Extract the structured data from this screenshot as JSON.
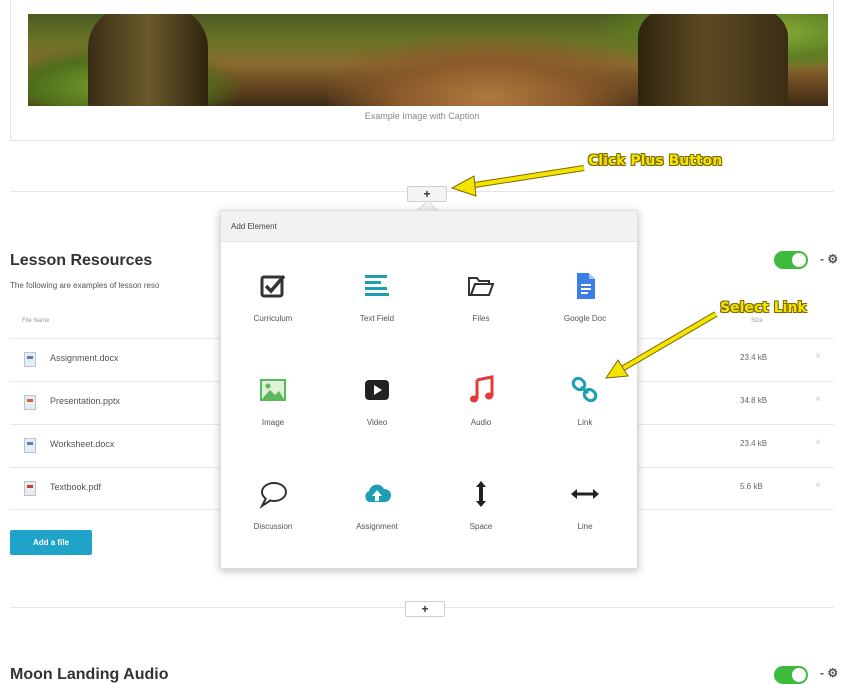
{
  "image_block": {
    "caption": "Example Image with Caption"
  },
  "annotations": {
    "click_plus": "Click Plus Button",
    "select_link": "Select Link"
  },
  "plus_label": "+",
  "lesson_resources": {
    "title": "Lesson Resources",
    "description": "The following are examples of lesson reso",
    "col_name": "File Name",
    "col_size": "Size",
    "files": [
      {
        "name": "Assignment.docx",
        "size": "23.4 kB"
      },
      {
        "name": "Presentation.pptx",
        "size": "34.8 kB"
      },
      {
        "name": "Worksheet.docx",
        "size": "23.4 kB"
      },
      {
        "name": "Textbook.pdf",
        "size": "5.6 kB"
      }
    ],
    "delete_symbol": "×",
    "add_file": "Add a file",
    "toggle_suffix": "- ⚙"
  },
  "add_element": {
    "header": "Add Element",
    "items": [
      {
        "label": "Curriculum",
        "icon": "checkbox-icon"
      },
      {
        "label": "Text Field",
        "icon": "text-lines-icon"
      },
      {
        "label": "Files",
        "icon": "folder-icon"
      },
      {
        "label": "Google Doc",
        "icon": "google-doc-icon"
      },
      {
        "label": "Image",
        "icon": "image-icon"
      },
      {
        "label": "Video",
        "icon": "play-icon"
      },
      {
        "label": "Audio",
        "icon": "music-note-icon"
      },
      {
        "label": "Link",
        "icon": "link-icon"
      },
      {
        "label": "Discussion",
        "icon": "speech-bubble-icon"
      },
      {
        "label": "Assignment",
        "icon": "cloud-upload-icon"
      },
      {
        "label": "Space",
        "icon": "vertical-arrows-icon"
      },
      {
        "label": "Line",
        "icon": "horizontal-arrows-icon"
      }
    ]
  },
  "moon_landing": {
    "title": "Moon Landing Audio",
    "toggle_suffix": "- ⚙"
  },
  "colors": {
    "accent": "#1fa3c9",
    "toggle_on": "#3dbb3d",
    "annotation": "#f5e400"
  }
}
